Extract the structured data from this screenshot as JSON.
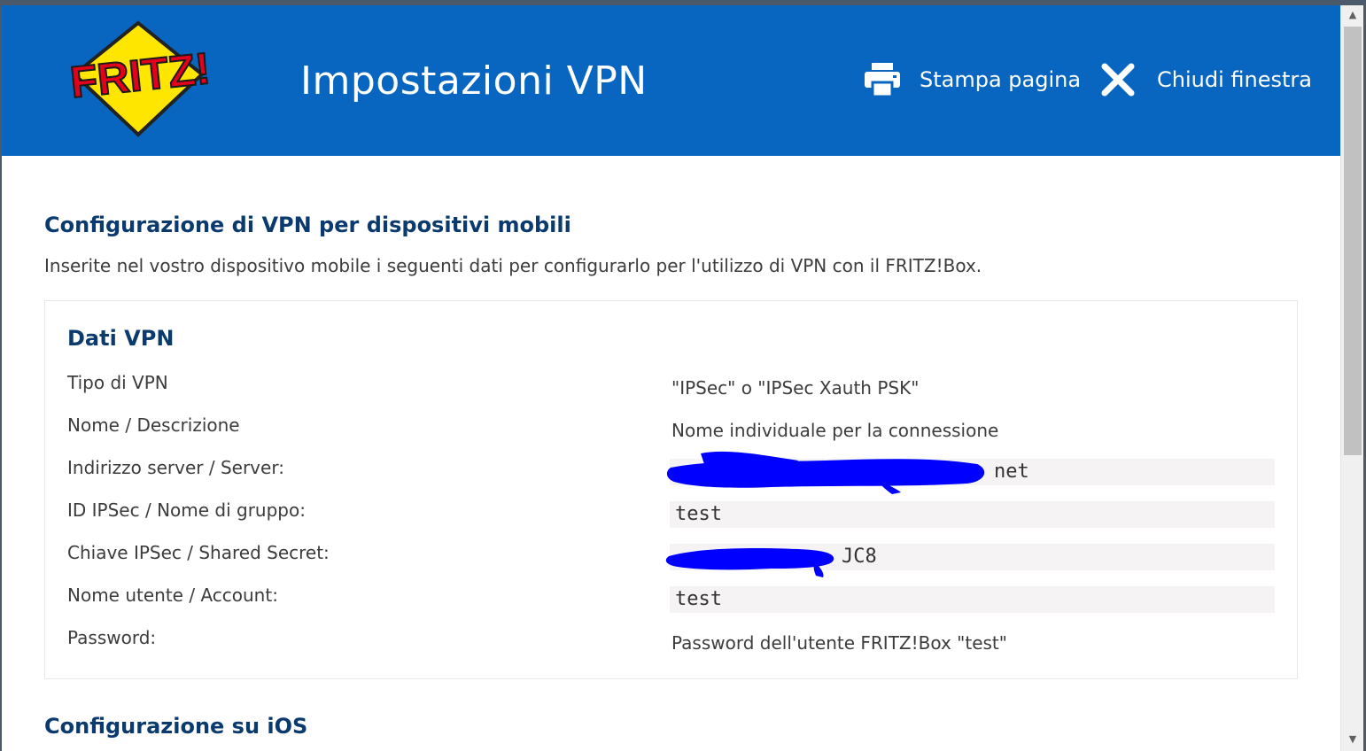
{
  "header": {
    "logo_text": "FRITZ!",
    "title": "Impostazioni VPN",
    "print_label": "Stampa pagina",
    "close_label": "Chiudi finestra"
  },
  "main": {
    "section_title": "Configurazione di VPN per dispositivi mobili",
    "intro": "Inserite nel vostro dispositivo mobile i seguenti dati per configurarlo per l'utilizzo di VPN con il FRITZ!Box.",
    "vpn_box": {
      "title": "Dati VPN",
      "rows": [
        {
          "label": "Tipo di VPN",
          "value": "\"IPSec\" o \"IPSec Xauth PSK\""
        },
        {
          "label": "Nome / Descrizione",
          "value": "Nome individuale per la connessione"
        },
        {
          "label": "Indirizzo server / Server:",
          "value": "net"
        },
        {
          "label": "ID IPSec / Nome di gruppo:",
          "value": "test"
        },
        {
          "label": "Chiave IPSec / Shared Secret:",
          "value": "JC8"
        },
        {
          "label": "Nome utente / Account:",
          "value": "test"
        },
        {
          "label": "Password:",
          "value": "Password dell'utente FRITZ!Box \"test\""
        }
      ]
    },
    "ios_title": "Configurazione su iOS"
  },
  "colors": {
    "header_bg": "#0866c1",
    "heading": "#0b3b6e",
    "redaction": "#0000ff",
    "logo_yellow": "#ffe600",
    "logo_red": "#e2001a"
  },
  "icons": {
    "print": "printer-icon",
    "close": "close-x-icon",
    "scroll_up": "scroll-up-arrow-icon",
    "scroll_down": "scroll-down-arrow-icon"
  }
}
